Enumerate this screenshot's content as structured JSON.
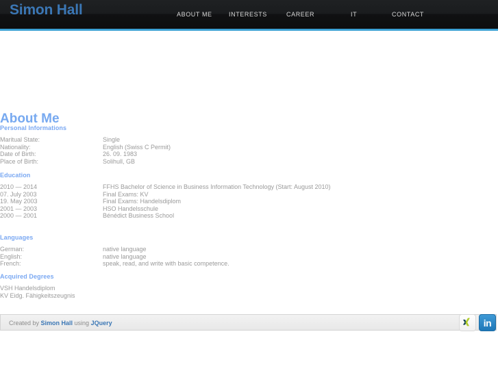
{
  "header": {
    "logo": "Simon Hall",
    "nav": [
      {
        "label": "ABOUT ME"
      },
      {
        "label": "INTERESTS"
      },
      {
        "label": "CAREER"
      },
      {
        "label": "IT"
      },
      {
        "label": "CONTACT"
      }
    ],
    "accent_color": "#3da2d4",
    "logo_color": "#3b77b5",
    "background_color": "#151617"
  },
  "main": {
    "page_title": "About Me",
    "sections": {
      "personal": {
        "title": "Personal Informations",
        "rows": [
          {
            "label": "Maritual State:",
            "value": "Single"
          },
          {
            "label": "Nationality:",
            "value": "English (Swiss C Permit)"
          },
          {
            "label": "Date of Birth:",
            "value": "26. 09. 1983"
          },
          {
            "label": "Place of Birth:",
            "value": "Solihull, GB"
          }
        ]
      },
      "education": {
        "title": "Education",
        "rows": [
          {
            "label": "2010 — 2014",
            "value": "FFHS Bachelor of Science in Business Information Technology (Start: August 2010)"
          },
          {
            "label": "07. July 2003",
            "value": "Final Exams: KV"
          },
          {
            "label": "19. May 2003",
            "value": "Final Exams: Handelsdiplom"
          },
          {
            "label": "2001 — 2003",
            "value": "HSO Handelsschule"
          },
          {
            "label": "2000 — 2001",
            "value": "Bénédict Business School"
          }
        ]
      },
      "languages": {
        "title": "Languages",
        "rows": [
          {
            "label": "German:",
            "value": "native language"
          },
          {
            "label": "English:",
            "value": "native language"
          },
          {
            "label": "French:",
            "value": "speak, read, and write with basic competence."
          }
        ]
      },
      "degrees": {
        "title": "Acquired Degrees",
        "lines": [
          "VSH Handelsdiplom",
          "KV Eidg. Fähigkeitszeugnis"
        ]
      }
    }
  },
  "footer": {
    "prefix": "Created by ",
    "author": "Simon Hall",
    "middle": " using ",
    "library": "JQuery",
    "social": [
      {
        "name": "xing",
        "label": "XING"
      },
      {
        "name": "linkedin",
        "label": "in"
      }
    ]
  }
}
